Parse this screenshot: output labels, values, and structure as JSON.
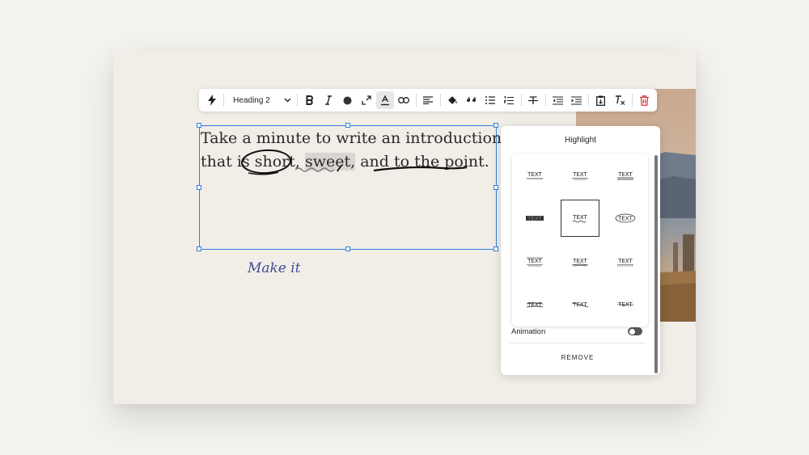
{
  "toolbar": {
    "heading_select": "Heading 2",
    "buttons": [
      "quick-actions",
      "bold",
      "italic",
      "text-color",
      "link-alt",
      "highlight",
      "link",
      "align-left",
      "fill",
      "quote",
      "bullet-list",
      "numbered-list",
      "strikethrough",
      "outdent",
      "indent",
      "paste",
      "clear-format",
      "delete"
    ],
    "delete_color": "#d93b3b"
  },
  "editor": {
    "line1": "Take a minute to write an introduction",
    "line2_prefix": "that is ",
    "word_short": "short,",
    "word_sweet": "sweet,",
    "word_and": " and ",
    "phrase_point": "to the point.",
    "selection_color": "#2f80e6"
  },
  "make_it": "Make it",
  "highlight_panel": {
    "title": "Highlight",
    "option_label": "TEXT",
    "styles": [
      "underline-thin",
      "underline-double-thin",
      "underline-double",
      "marker-block",
      "squiggle",
      "circle",
      "underline-box",
      "underline-scribble",
      "underline-dotted",
      "strike-scribble",
      "strike-swoop",
      "strike-wave"
    ],
    "selected_index": 4,
    "animation_label": "Animation",
    "animation_on": false,
    "remove_label": "REMOVE"
  }
}
